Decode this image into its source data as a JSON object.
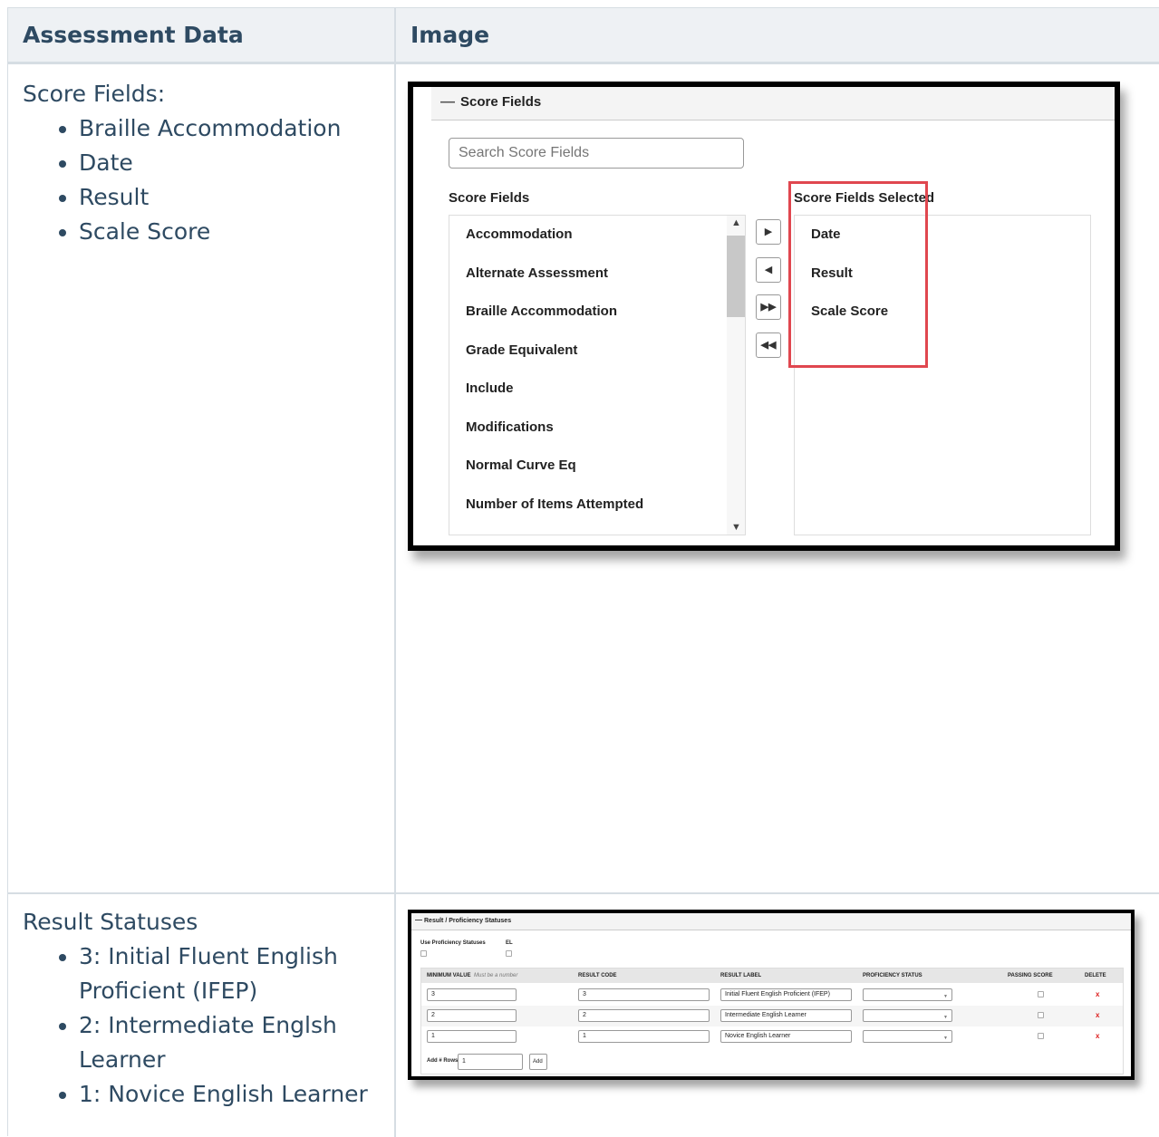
{
  "table": {
    "headers": [
      "Assessment Data",
      "Image"
    ],
    "rows": [
      {
        "title": "Score Fields:",
        "items": [
          "Braille Accommodation",
          "Date",
          "Result",
          "Scale Score"
        ]
      },
      {
        "title": "Result Statuses",
        "items": [
          "3: Initial Fluent English Proficient (IFEP)",
          "2: Intermediate Englsh Learner",
          "1: Novice English Learner"
        ]
      }
    ]
  },
  "score_fields_panel": {
    "title": "Score Fields",
    "search_placeholder": "Search Score Fields",
    "available_label": "Score Fields",
    "selected_label": "Score Fields Selected",
    "available": [
      "Accommodation",
      "Alternate Assessment",
      "Braille Accommodation",
      "Grade Equivalent",
      "Include",
      "Modifications",
      "Normal Curve Eq",
      "Number of Items Attempted"
    ],
    "selected": [
      "Date",
      "Result",
      "Scale Score"
    ],
    "highlight_color": "#e0474f"
  },
  "result_panel": {
    "title": "Result / Proficiency Statuses",
    "use_prof_label": "Use Proficiency Statuses",
    "el_label": "EL",
    "columns": [
      "MINIMUM VALUE",
      "RESULT CODE",
      "RESULT LABEL",
      "PROFICIENCY STATUS",
      "PASSING SCORE",
      "DELETE"
    ],
    "min_value_hint": "Must be a number",
    "rows": [
      {
        "min": "3",
        "code": "3",
        "label": "Initial Fluent English Proficient (IFEP)"
      },
      {
        "min": "2",
        "code": "2",
        "label": "Intermediate English Learner"
      },
      {
        "min": "1",
        "code": "1",
        "label": "Novice English Learner"
      }
    ],
    "delete_glyph": "x",
    "add_rows_label": "Add # Rows",
    "add_rows_value": "1",
    "add_button": "Add"
  }
}
